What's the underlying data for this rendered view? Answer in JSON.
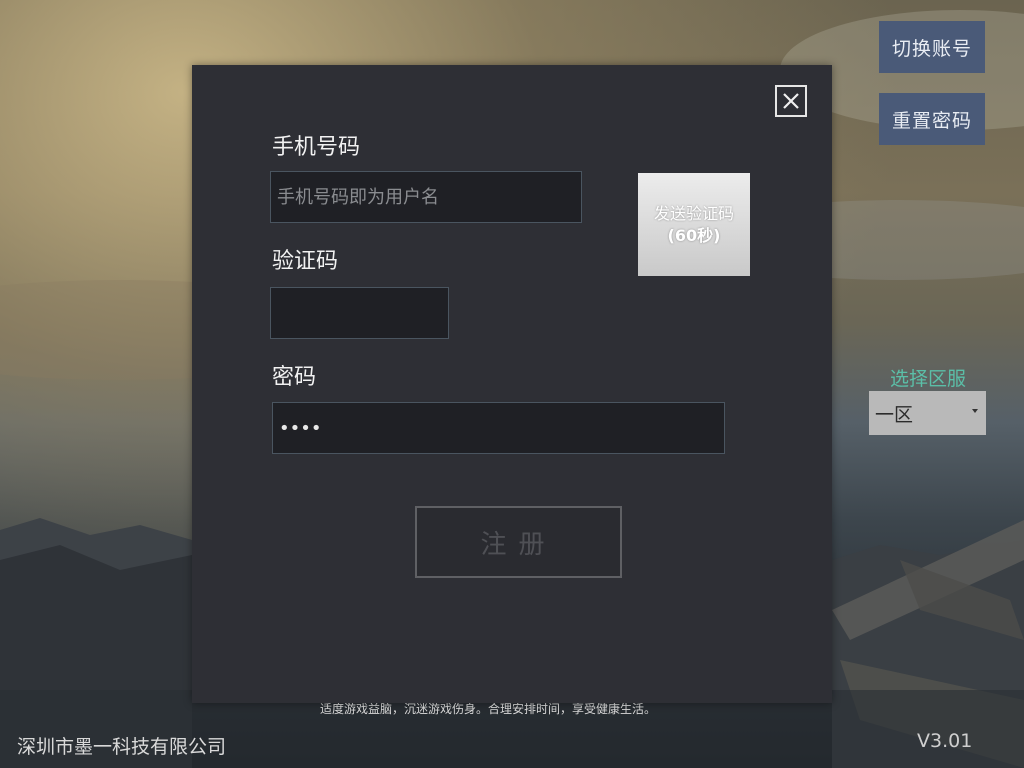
{
  "top_buttons": {
    "switch_account": "切换账号",
    "reset_password": "重置密码"
  },
  "region": {
    "label": "选择区服",
    "selected": "一区"
  },
  "footer": {
    "notice": "适度游戏益脑，沉迷游戏伤身。合理安排时间，享受健康生活。",
    "company": "深圳市墨一科技有限公司",
    "version": "V3.01"
  },
  "register_dialog": {
    "phone_label": "手机号码",
    "phone_placeholder": "手机号码即为用户名",
    "phone_value": "",
    "send_code_label": "发送验证码",
    "send_code_countdown": "(60秒)",
    "code_label": "验证码",
    "code_value": "",
    "password_label": "密码",
    "password_value": "••••",
    "register_label": "注册",
    "close_icon": "close-icon"
  },
  "colors": {
    "dialog_bg": "#2e2f35",
    "side_button_bg": "#4a5a78",
    "region_label": "#5bbfa8"
  }
}
